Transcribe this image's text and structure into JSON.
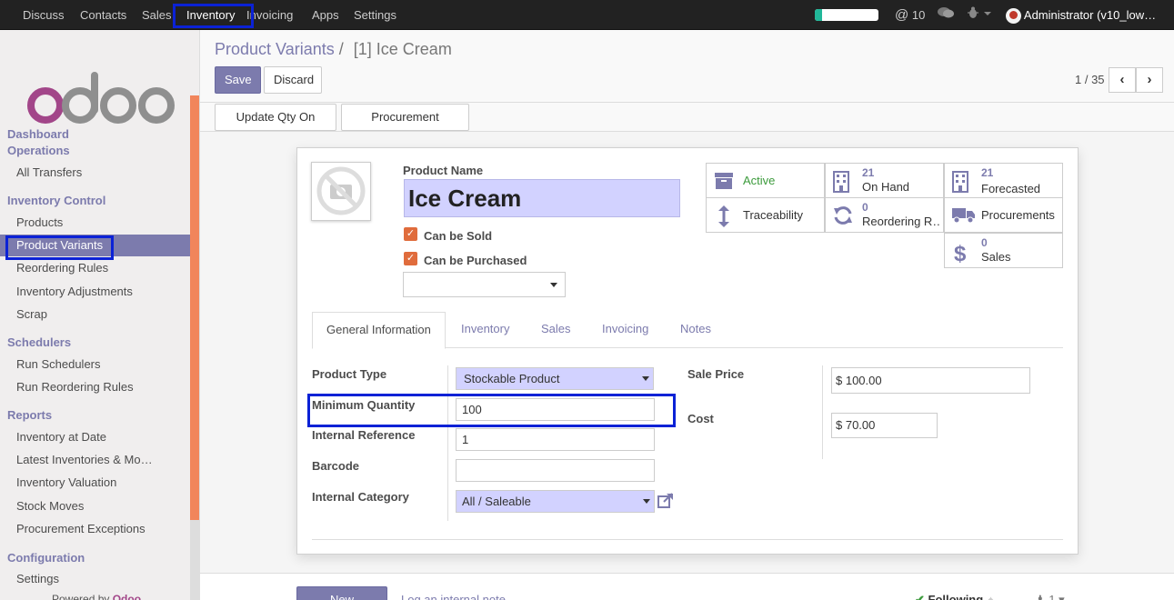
{
  "topbar": {
    "menus": [
      "Discuss",
      "Contacts",
      "Sales",
      "Inventory",
      "Invoicing",
      "Apps",
      "Settings"
    ],
    "active_menu": "Inventory",
    "mentions": "10",
    "user": "Administrator (v10_low…",
    "progress_fraction": 0.12
  },
  "sidebar": {
    "sections": {
      "dashboard": "Dashboard",
      "operations": "Operations",
      "inventory_control": "Inventory Control",
      "schedulers": "Schedulers",
      "reports": "Reports",
      "configuration": "Configuration"
    },
    "items": {
      "all_transfers": "All Transfers",
      "products": "Products",
      "product_variants": "Product Variants",
      "reordering_rules": "Reordering Rules",
      "inventory_adjustments": "Inventory Adjustments",
      "scrap": "Scrap",
      "run_schedulers": "Run Schedulers",
      "run_reordering_rules": "Run Reordering Rules",
      "inventory_at_date": "Inventory at Date",
      "latest_inventories": "Latest Inventories & Mo…",
      "inventory_valuation": "Inventory Valuation",
      "stock_moves": "Stock Moves",
      "procurement_exceptions": "Procurement Exceptions",
      "settings": "Settings"
    },
    "powered_by": "Powered by",
    "powered_brand": "Odoo"
  },
  "control_panel": {
    "breadcrumb_parent": "Product Variants",
    "breadcrumb_sep": "/",
    "breadcrumb_current": "[1] Ice Cream",
    "save": "Save",
    "discard": "Discard",
    "pager": "1 / 35",
    "prev": "‹",
    "next": "›"
  },
  "header_buttons": {
    "update_qty": "Update Qty On Hand",
    "procurement_request": "Procurement Request"
  },
  "form": {
    "product_name_label": "Product Name",
    "product_name": "Ice Cream",
    "can_be_sold": "Can be Sold",
    "can_be_purchased": "Can be Purchased",
    "stats": {
      "active": "Active",
      "on_hand_value": "21",
      "on_hand": "On Hand",
      "forecasted_value": "21",
      "forecasted": "Forecasted",
      "traceability": "Traceability",
      "reordering_value": "0",
      "reordering": "Reordering R…",
      "procurements": "Procurements",
      "sales_value": "0",
      "sales": "Sales"
    },
    "tabs": [
      "General Information",
      "Inventory",
      "Sales",
      "Invoicing",
      "Notes"
    ],
    "fields": {
      "product_type_label": "Product Type",
      "product_type": "Stockable Product",
      "min_qty_label": "Minimum Quantity",
      "min_qty": "100",
      "internal_ref_label": "Internal Reference",
      "internal_ref": "1",
      "barcode_label": "Barcode",
      "barcode": "",
      "internal_category_label": "Internal Category",
      "internal_category": "All / Saleable",
      "sale_price_label": "Sale Price",
      "sale_price": "$ 100.00",
      "cost_label": "Cost",
      "cost": "$ 70.00"
    }
  },
  "chatter": {
    "new_message": "New message",
    "log_note": "Log an internal note",
    "following": "Following",
    "followers": "1"
  },
  "colors": {
    "primary": "#7c7bad",
    "highlight": "#0b22d6",
    "accent": "#f1855b",
    "checkbox": "#e06c3c"
  }
}
